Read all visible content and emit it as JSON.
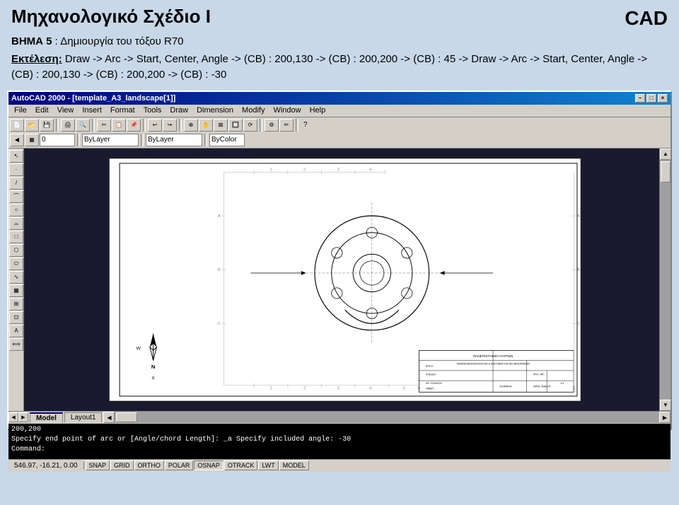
{
  "header": {
    "title": "Μηχανολογικό Σχέδιο  Ι",
    "cad_label": "CAD"
  },
  "instructions": {
    "step_label": "ΒΗΜΑ 5",
    "step_colon": " : ",
    "step_desc": "Δημιουργία του τόξου R70",
    "exec_label": "Εκτέλεση:",
    "exec_text": " Draw -> Arc -> Start, Center, Angle -> (CB) : 200,130 -> (CB) : 200,200 -> (CB) : 45 -> Draw -> Arc -> Start, Center, Angle -> (CB) : 200,130 -> (CB) : 200,200 -> (CB) : -30"
  },
  "window": {
    "title": "AutoCAD 2000 - [template_A3_landscape[1]]",
    "controls": {
      "minimize": "−",
      "maximize": "□",
      "close": "×"
    }
  },
  "menu": {
    "items": [
      "File",
      "Edit",
      "View",
      "Insert",
      "Format",
      "Tools",
      "Draw",
      "Dimension",
      "Modify",
      "Window",
      "Help"
    ]
  },
  "toolbar": {
    "layer_dropdown": "0",
    "linetype_dropdown": "ByLayer",
    "lineweight_dropdown": "ByLayer",
    "color_dropdown": "ByColor"
  },
  "tabs": {
    "model": "Model",
    "layout1": "Layout1"
  },
  "command_lines": [
    "200,200",
    "Specify end point of arc or [Angle/chord Length]:  _a  Specify included angle: -30",
    "Command:"
  ],
  "status": {
    "coords": "546.97, -16.21, 0.00",
    "snap": "SNAP",
    "grid": "GRID",
    "ortho": "ORTHO",
    "polar": "POLAR",
    "osnap": "OSNAP",
    "otrack": "OTRACK",
    "lwt": "LWT",
    "model": "MODEL"
  },
  "drawing": {
    "bg_color": "#1a1a2e",
    "paper_color": "#ffffff",
    "line_color": "#000000"
  }
}
